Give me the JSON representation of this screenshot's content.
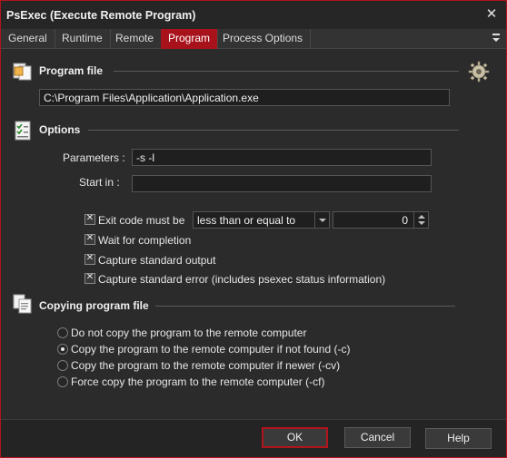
{
  "window": {
    "title": "PsExec (Execute Remote Program)",
    "close_glyph": "✕"
  },
  "tabs": [
    {
      "label": "General"
    },
    {
      "label": "Runtime"
    },
    {
      "label": "Remote"
    },
    {
      "label": "Program",
      "active": true
    },
    {
      "label": "Process Options"
    }
  ],
  "program_file": {
    "title": "Program file",
    "path": "C:\\Program Files\\Application\\Application.exe",
    "icon": "folder-file-icon",
    "settings_icon": "gear-icon"
  },
  "options": {
    "title": "Options",
    "icon": "checklist-icon",
    "parameters_label": "Parameters :",
    "parameters_value": "-s -l",
    "start_in_label": "Start in :",
    "start_in_value": "",
    "exit_code_label": "Exit code must be",
    "exit_code_checked": true,
    "exit_code_operator": "less than or equal to",
    "exit_code_value": "0",
    "wait_label": "Wait for completion",
    "wait_checked": true,
    "capture_output_label": "Capture standard output",
    "capture_output_checked": true,
    "capture_error_label": "Capture standard error (includes psexec status information)",
    "capture_error_checked": true
  },
  "copying": {
    "title": "Copying program file",
    "icon": "copy-files-icon",
    "choices": [
      {
        "label": "Do not copy the program to the remote computer",
        "checked": false
      },
      {
        "label": "Copy the program to the remote computer if not found (-c)",
        "checked": true
      },
      {
        "label": "Copy the program to the remote computer if newer (-cv)",
        "checked": false
      },
      {
        "label": "Force copy the program to the remote computer (-cf)",
        "checked": false
      }
    ]
  },
  "buttons": {
    "ok": "OK",
    "cancel": "Cancel",
    "help": "Help"
  },
  "colors": {
    "accent": "#a8121b",
    "background": "#2b2b2b"
  }
}
